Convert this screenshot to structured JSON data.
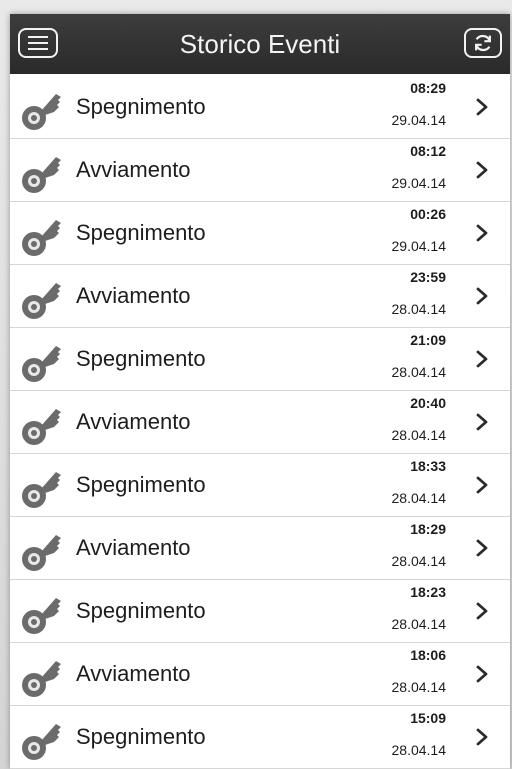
{
  "header": {
    "title": "Storico Eventi",
    "menu_icon": "menu-icon",
    "refresh_icon": "refresh-icon"
  },
  "colors": {
    "header_bg": "#2f2f2f",
    "key_icon": "#6b6b6b",
    "chevron": "#2b2b2b"
  },
  "events": [
    {
      "label": "Spegnimento",
      "time": "08:29",
      "date": "29.04.14"
    },
    {
      "label": "Avviamento",
      "time": "08:12",
      "date": "29.04.14"
    },
    {
      "label": "Spegnimento",
      "time": "00:26",
      "date": "29.04.14"
    },
    {
      "label": "Avviamento",
      "time": "23:59",
      "date": "28.04.14"
    },
    {
      "label": "Spegnimento",
      "time": "21:09",
      "date": "28.04.14"
    },
    {
      "label": "Avviamento",
      "time": "20:40",
      "date": "28.04.14"
    },
    {
      "label": "Spegnimento",
      "time": "18:33",
      "date": "28.04.14"
    },
    {
      "label": "Avviamento",
      "time": "18:29",
      "date": "28.04.14"
    },
    {
      "label": "Spegnimento",
      "time": "18:23",
      "date": "28.04.14"
    },
    {
      "label": "Avviamento",
      "time": "18:06",
      "date": "28.04.14"
    },
    {
      "label": "Spegnimento",
      "time": "15:09",
      "date": "28.04.14"
    }
  ]
}
